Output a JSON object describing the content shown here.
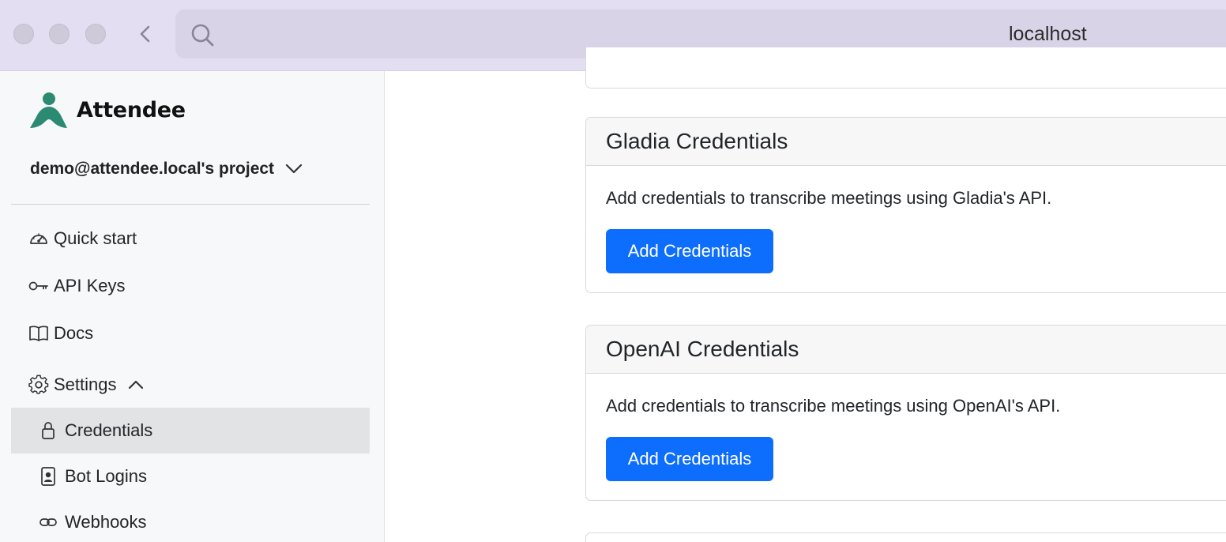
{
  "browser": {
    "url": "localhost",
    "traffic_lights": [
      "close",
      "minimize",
      "zoom"
    ],
    "back_icon": "chevron-left-icon",
    "search_icon": "search-icon"
  },
  "sidebar": {
    "brand": "Attendee",
    "brand_color": "#2a8a72",
    "project": "demo@attendee.local's project",
    "items": [
      {
        "label": "Quick start",
        "icon": "speedometer-icon"
      },
      {
        "label": "API Keys",
        "icon": "key-icon"
      },
      {
        "label": "Docs",
        "icon": "book-icon"
      },
      {
        "label": "Settings",
        "icon": "gear-icon",
        "expanded": true
      }
    ],
    "subitems": [
      {
        "label": "Credentials",
        "icon": "lock-icon",
        "active": true
      },
      {
        "label": "Bot Logins",
        "icon": "person-badge-icon"
      },
      {
        "label": "Webhooks",
        "icon": "link-icon"
      }
    ]
  },
  "main": {
    "cards": [
      {
        "title": "Gladia Credentials",
        "description": "Add credentials to transcribe meetings using Gladia's API.",
        "button": "Add Credentials"
      },
      {
        "title": "OpenAI Credentials",
        "description": "Add credentials to transcribe meetings using OpenAI's API.",
        "button": "Add Credentials"
      }
    ]
  },
  "colors": {
    "primary_button": "#0d6efd",
    "active_nav_bg": "#e2e3e5",
    "chrome_bg": "#e4def2"
  }
}
